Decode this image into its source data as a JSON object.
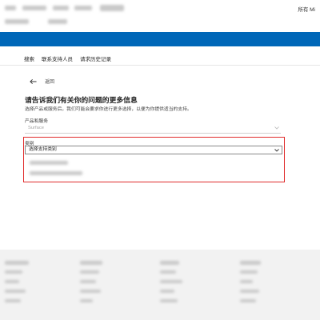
{
  "header": {
    "account_text": "所有 Mi"
  },
  "nav": {
    "tabs": [
      {
        "label": "搜索"
      },
      {
        "label": "联系支持人员"
      },
      {
        "label": "请求历史记录"
      }
    ]
  },
  "back": {
    "label": "返回"
  },
  "page": {
    "heading": "请告诉我们有关你的问题的更多信息",
    "subtext": "选择产品或服务后，我们可能会要求你进行更多选择，以便为你提供适当的支持。"
  },
  "product_field": {
    "label": "产品和服务",
    "value": "Surface"
  },
  "category_field": {
    "label": "类别",
    "placeholder": "选择支持类别"
  },
  "colors": {
    "brand_blue": "#0067b8",
    "highlight_red": "#e02b2b",
    "footer_bg": "#f2f2f2"
  },
  "icons": {
    "back": "arrow-left-icon",
    "dropdown": "chevron-down-icon"
  }
}
